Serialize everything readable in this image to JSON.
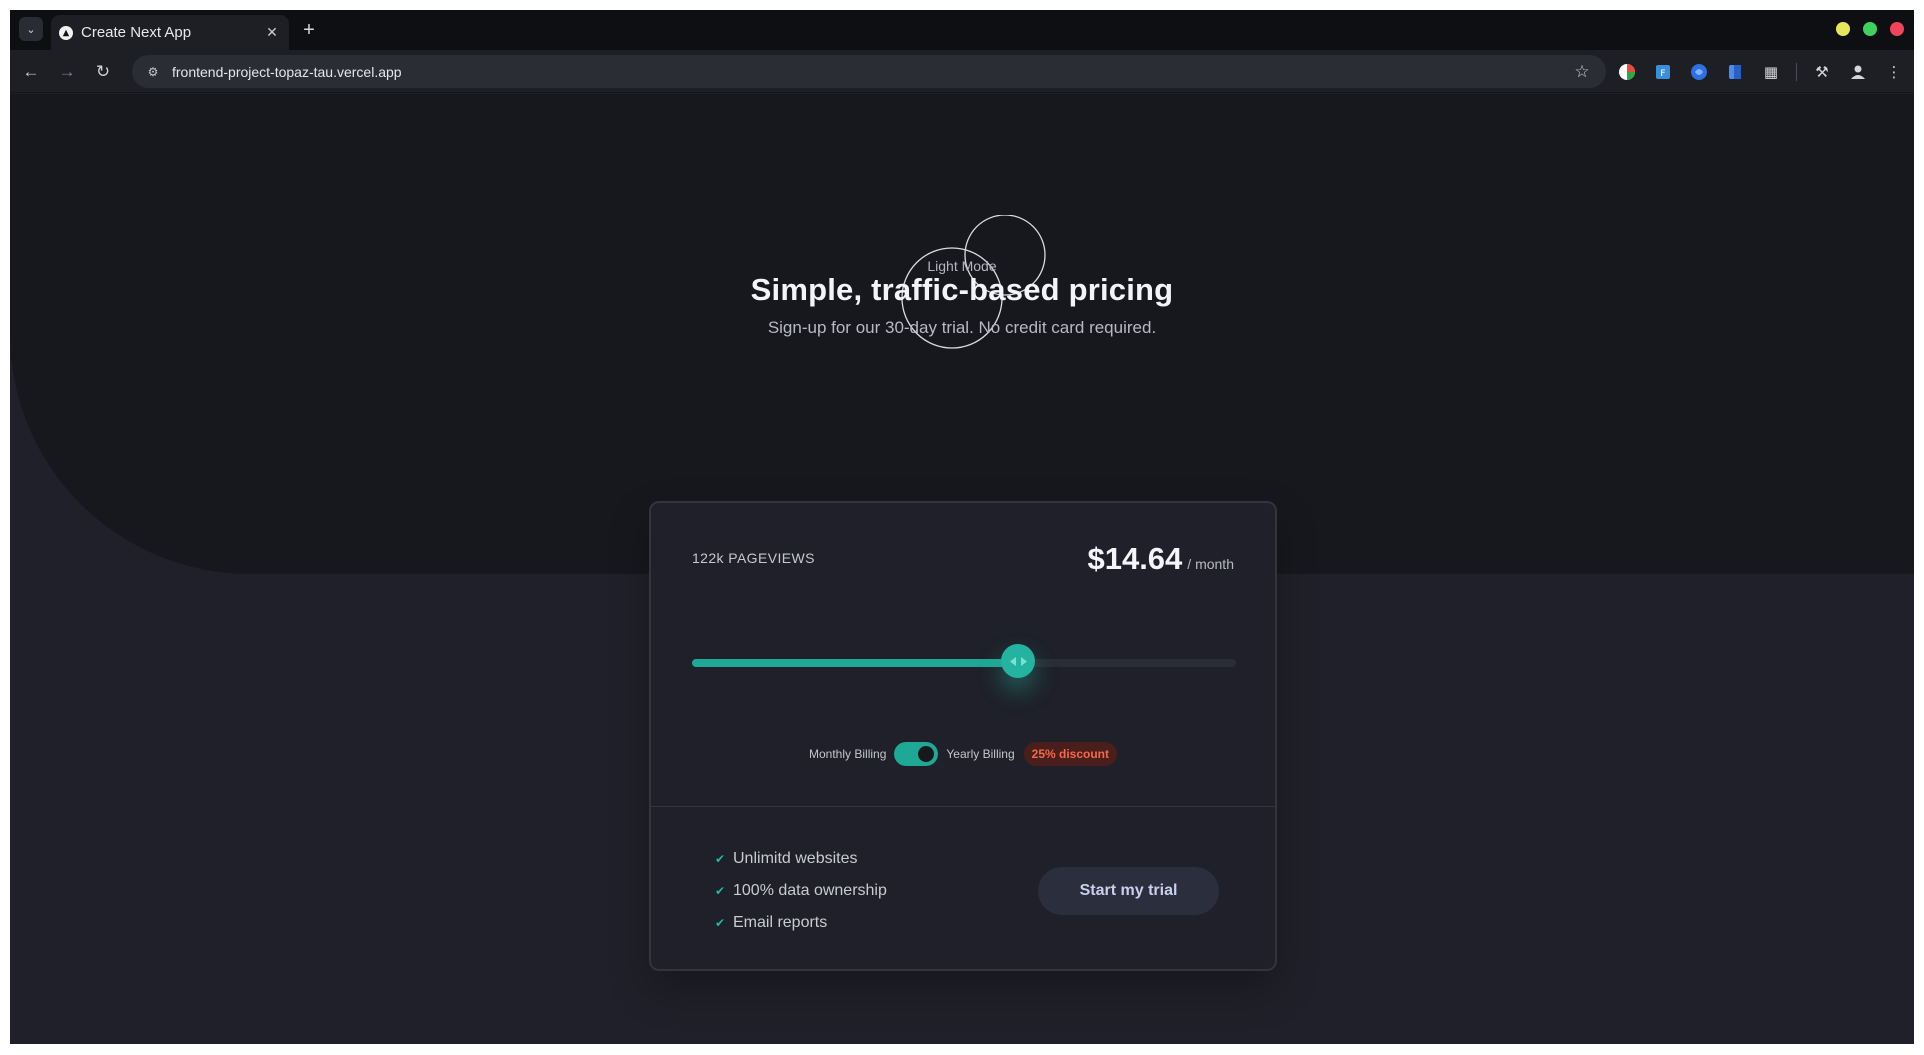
{
  "browser": {
    "tab_title": "Create Next App",
    "url": "frontend-project-topaz-tau.vercel.app",
    "window_colors": {
      "minimize": "#e6e65a",
      "maximize": "#3fd15f",
      "close": "#f0445a"
    },
    "icons": [
      "tab-list-icon",
      "close-icon",
      "plus-icon",
      "back-icon",
      "forward-icon",
      "reload-icon",
      "site-info-icon",
      "star-icon",
      "extension-icon",
      "labs-icon",
      "profile-icon",
      "menu-icon"
    ]
  },
  "hero": {
    "title": "Simple, traffic-based pricing",
    "subtitle": "Sign-up for our 30-day trial. No credit card required.",
    "mode_label": "Light Mode"
  },
  "pricing": {
    "pageviews": "122k PAGEVIEWS",
    "price": "$14.64",
    "period": "/ month",
    "slider_fraction": 0.6,
    "billing_monthly": "Monthly Billing",
    "billing_yearly": "Yearly Billing",
    "yearly_enabled": true,
    "discount": "25% discount",
    "features": [
      "Unlimitd websites",
      "100% data ownership",
      "Email reports"
    ],
    "cta": "Start my trial",
    "accent": "#1ea896",
    "discount_color": "#f26a4b"
  }
}
